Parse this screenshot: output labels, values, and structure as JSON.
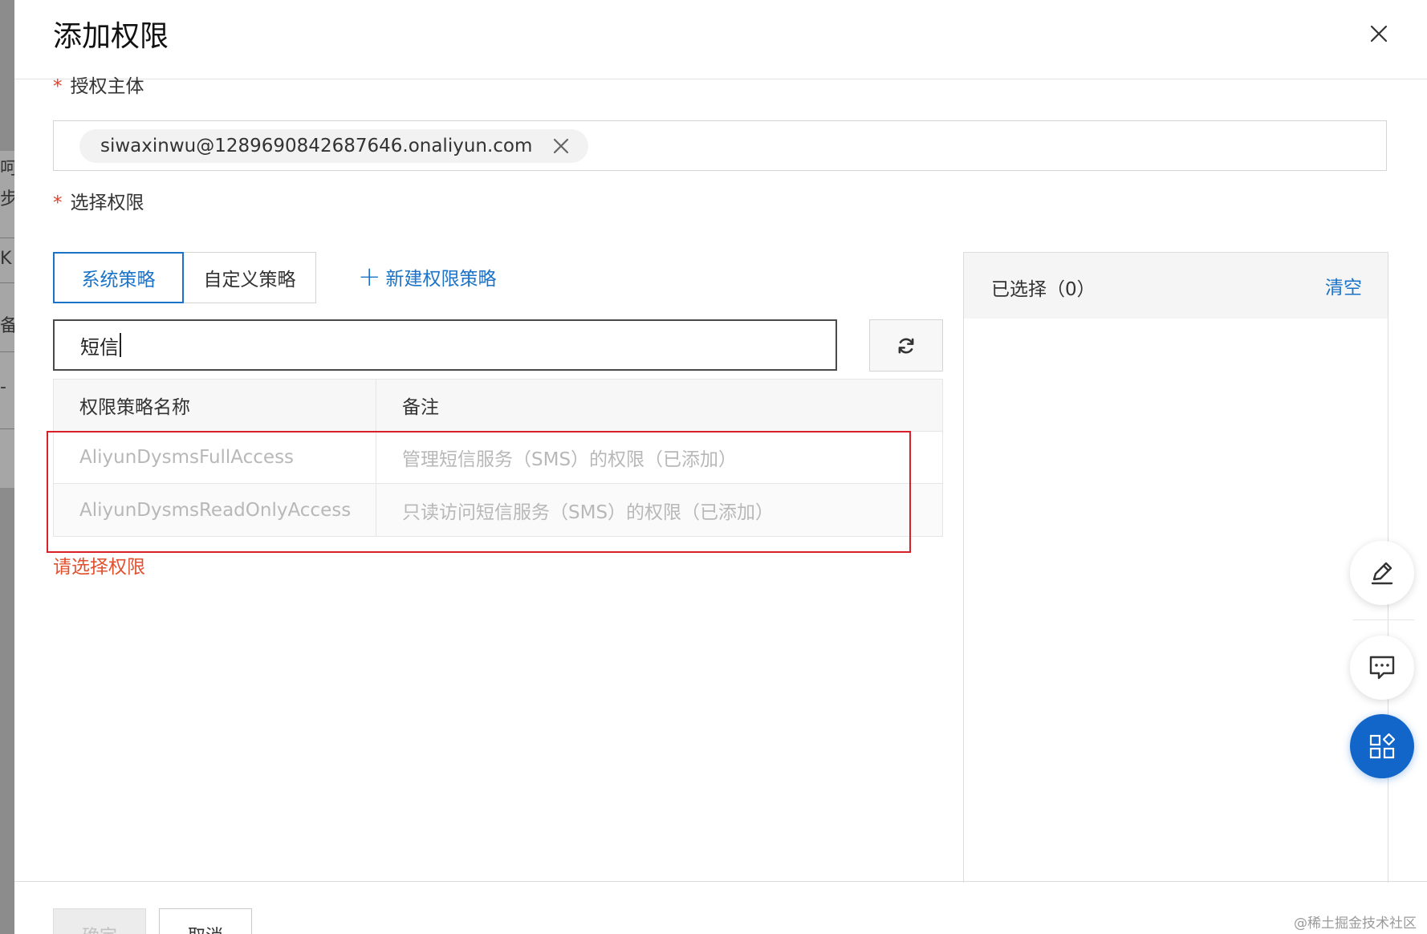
{
  "background": {
    "glyphs": [
      "呵",
      "步",
      "K",
      "备",
      "-"
    ]
  },
  "dialog": {
    "title": "添加权限",
    "close_icon": "close-icon"
  },
  "principal": {
    "required_mark": "*",
    "label": "授权主体",
    "tag_value": "siwaxinwu@1289690842687646.onaliyun.com",
    "tag_remove_icon": "close-icon"
  },
  "permissions": {
    "required_mark": "*",
    "label": "选择权限",
    "tabs": [
      {
        "label": "系统策略",
        "active": true
      },
      {
        "label": "自定义策略",
        "active": false
      }
    ],
    "new_policy": {
      "icon": "plus-icon",
      "label": "新建权限策略"
    },
    "search": {
      "value": "短信"
    },
    "refresh_icon": "refresh-icon",
    "table": {
      "columns": [
        "权限策略名称",
        "备注"
      ],
      "rows": [
        {
          "name": "AliyunDysmsFullAccess",
          "note": "管理短信服务（SMS）的权限（已添加）"
        },
        {
          "name": "AliyunDysmsReadOnlyAccess",
          "note": "只读访问短信服务（SMS）的权限（已添加）"
        }
      ]
    },
    "error": "请选择权限"
  },
  "selected": {
    "title": "已选择（0）",
    "clear": "清空"
  },
  "footer": {
    "confirm": "确定",
    "cancel": "取消"
  },
  "floating": [
    {
      "icon": "edit-icon"
    },
    {
      "icon": "chat-icon"
    },
    {
      "icon": "apps-icon"
    }
  ],
  "watermark": "@稀土掘金技术社区",
  "colors": {
    "primary": "#1b73c8",
    "error": "#e2502f",
    "required": "#e23f2a",
    "highlight": "#d8202a",
    "float_accent": "#1266c9"
  }
}
